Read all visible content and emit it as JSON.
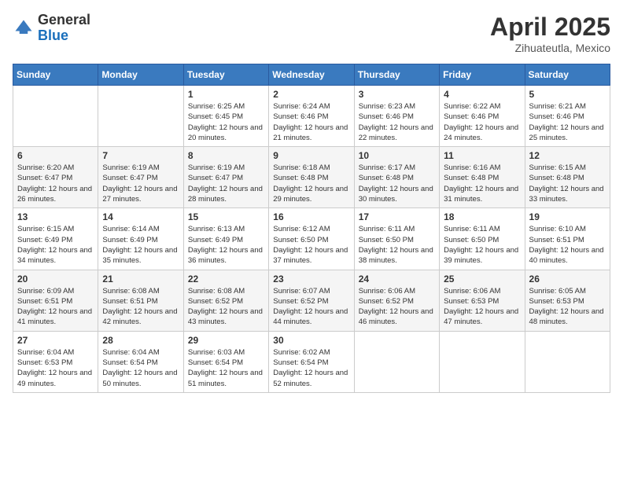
{
  "logo": {
    "general": "General",
    "blue": "Blue"
  },
  "header": {
    "month": "April 2025",
    "location": "Zihuateutla, Mexico"
  },
  "weekdays": [
    "Sunday",
    "Monday",
    "Tuesday",
    "Wednesday",
    "Thursday",
    "Friday",
    "Saturday"
  ],
  "weeks": [
    [
      {
        "day": null
      },
      {
        "day": null
      },
      {
        "day": "1",
        "sunrise": "Sunrise: 6:25 AM",
        "sunset": "Sunset: 6:45 PM",
        "daylight": "Daylight: 12 hours and 20 minutes."
      },
      {
        "day": "2",
        "sunrise": "Sunrise: 6:24 AM",
        "sunset": "Sunset: 6:46 PM",
        "daylight": "Daylight: 12 hours and 21 minutes."
      },
      {
        "day": "3",
        "sunrise": "Sunrise: 6:23 AM",
        "sunset": "Sunset: 6:46 PM",
        "daylight": "Daylight: 12 hours and 22 minutes."
      },
      {
        "day": "4",
        "sunrise": "Sunrise: 6:22 AM",
        "sunset": "Sunset: 6:46 PM",
        "daylight": "Daylight: 12 hours and 24 minutes."
      },
      {
        "day": "5",
        "sunrise": "Sunrise: 6:21 AM",
        "sunset": "Sunset: 6:46 PM",
        "daylight": "Daylight: 12 hours and 25 minutes."
      }
    ],
    [
      {
        "day": "6",
        "sunrise": "Sunrise: 6:20 AM",
        "sunset": "Sunset: 6:47 PM",
        "daylight": "Daylight: 12 hours and 26 minutes."
      },
      {
        "day": "7",
        "sunrise": "Sunrise: 6:19 AM",
        "sunset": "Sunset: 6:47 PM",
        "daylight": "Daylight: 12 hours and 27 minutes."
      },
      {
        "day": "8",
        "sunrise": "Sunrise: 6:19 AM",
        "sunset": "Sunset: 6:47 PM",
        "daylight": "Daylight: 12 hours and 28 minutes."
      },
      {
        "day": "9",
        "sunrise": "Sunrise: 6:18 AM",
        "sunset": "Sunset: 6:48 PM",
        "daylight": "Daylight: 12 hours and 29 minutes."
      },
      {
        "day": "10",
        "sunrise": "Sunrise: 6:17 AM",
        "sunset": "Sunset: 6:48 PM",
        "daylight": "Daylight: 12 hours and 30 minutes."
      },
      {
        "day": "11",
        "sunrise": "Sunrise: 6:16 AM",
        "sunset": "Sunset: 6:48 PM",
        "daylight": "Daylight: 12 hours and 31 minutes."
      },
      {
        "day": "12",
        "sunrise": "Sunrise: 6:15 AM",
        "sunset": "Sunset: 6:48 PM",
        "daylight": "Daylight: 12 hours and 33 minutes."
      }
    ],
    [
      {
        "day": "13",
        "sunrise": "Sunrise: 6:15 AM",
        "sunset": "Sunset: 6:49 PM",
        "daylight": "Daylight: 12 hours and 34 minutes."
      },
      {
        "day": "14",
        "sunrise": "Sunrise: 6:14 AM",
        "sunset": "Sunset: 6:49 PM",
        "daylight": "Daylight: 12 hours and 35 minutes."
      },
      {
        "day": "15",
        "sunrise": "Sunrise: 6:13 AM",
        "sunset": "Sunset: 6:49 PM",
        "daylight": "Daylight: 12 hours and 36 minutes."
      },
      {
        "day": "16",
        "sunrise": "Sunrise: 6:12 AM",
        "sunset": "Sunset: 6:50 PM",
        "daylight": "Daylight: 12 hours and 37 minutes."
      },
      {
        "day": "17",
        "sunrise": "Sunrise: 6:11 AM",
        "sunset": "Sunset: 6:50 PM",
        "daylight": "Daylight: 12 hours and 38 minutes."
      },
      {
        "day": "18",
        "sunrise": "Sunrise: 6:11 AM",
        "sunset": "Sunset: 6:50 PM",
        "daylight": "Daylight: 12 hours and 39 minutes."
      },
      {
        "day": "19",
        "sunrise": "Sunrise: 6:10 AM",
        "sunset": "Sunset: 6:51 PM",
        "daylight": "Daylight: 12 hours and 40 minutes."
      }
    ],
    [
      {
        "day": "20",
        "sunrise": "Sunrise: 6:09 AM",
        "sunset": "Sunset: 6:51 PM",
        "daylight": "Daylight: 12 hours and 41 minutes."
      },
      {
        "day": "21",
        "sunrise": "Sunrise: 6:08 AM",
        "sunset": "Sunset: 6:51 PM",
        "daylight": "Daylight: 12 hours and 42 minutes."
      },
      {
        "day": "22",
        "sunrise": "Sunrise: 6:08 AM",
        "sunset": "Sunset: 6:52 PM",
        "daylight": "Daylight: 12 hours and 43 minutes."
      },
      {
        "day": "23",
        "sunrise": "Sunrise: 6:07 AM",
        "sunset": "Sunset: 6:52 PM",
        "daylight": "Daylight: 12 hours and 44 minutes."
      },
      {
        "day": "24",
        "sunrise": "Sunrise: 6:06 AM",
        "sunset": "Sunset: 6:52 PM",
        "daylight": "Daylight: 12 hours and 46 minutes."
      },
      {
        "day": "25",
        "sunrise": "Sunrise: 6:06 AM",
        "sunset": "Sunset: 6:53 PM",
        "daylight": "Daylight: 12 hours and 47 minutes."
      },
      {
        "day": "26",
        "sunrise": "Sunrise: 6:05 AM",
        "sunset": "Sunset: 6:53 PM",
        "daylight": "Daylight: 12 hours and 48 minutes."
      }
    ],
    [
      {
        "day": "27",
        "sunrise": "Sunrise: 6:04 AM",
        "sunset": "Sunset: 6:53 PM",
        "daylight": "Daylight: 12 hours and 49 minutes."
      },
      {
        "day": "28",
        "sunrise": "Sunrise: 6:04 AM",
        "sunset": "Sunset: 6:54 PM",
        "daylight": "Daylight: 12 hours and 50 minutes."
      },
      {
        "day": "29",
        "sunrise": "Sunrise: 6:03 AM",
        "sunset": "Sunset: 6:54 PM",
        "daylight": "Daylight: 12 hours and 51 minutes."
      },
      {
        "day": "30",
        "sunrise": "Sunrise: 6:02 AM",
        "sunset": "Sunset: 6:54 PM",
        "daylight": "Daylight: 12 hours and 52 minutes."
      },
      {
        "day": null
      },
      {
        "day": null
      },
      {
        "day": null
      }
    ]
  ]
}
